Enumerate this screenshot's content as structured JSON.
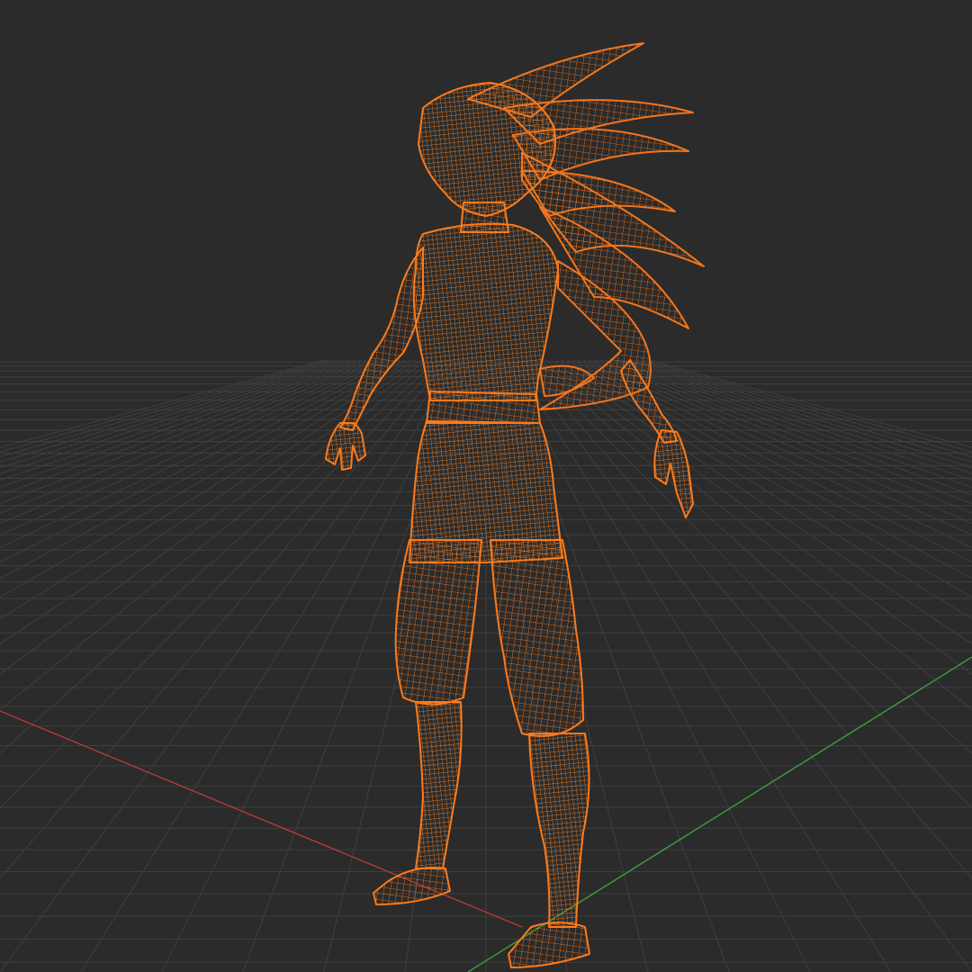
{
  "viewport": {
    "shading_mode": "wireframe",
    "object": "character-model",
    "colors": {
      "background": "#2b2b2b",
      "grid": "#3f3f3f",
      "axis_x": "#b33a3a",
      "axis_y": "#3f9a3f",
      "wire": "#ff7a1a",
      "fill": "#c85a10"
    }
  }
}
